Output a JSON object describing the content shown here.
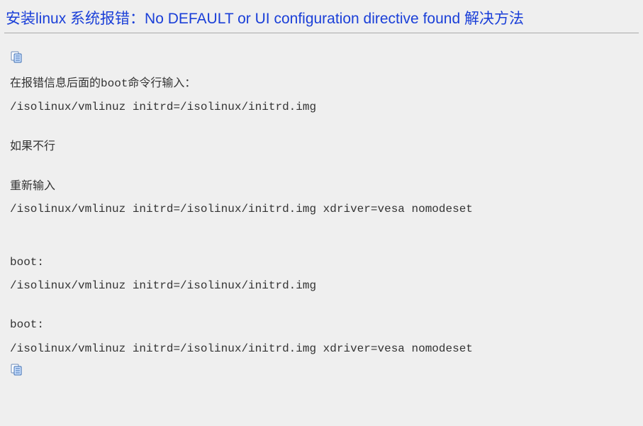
{
  "title": "安装linux 系统报错：No DEFAULT or UI configuration directive found 解决方法",
  "body": {
    "intro_prefix": "在报错信息后面的",
    "intro_boot": "boot",
    "intro_suffix": "命令行输入：",
    "cmd1": "/isolinux/vmlinuz initrd=/isolinux/initrd.img",
    "if_not": "如果不行",
    "retype": "重新输入",
    "cmd2": "/isolinux/vmlinuz initrd=/isolinux/initrd.img xdriver=vesa nomodeset",
    "boot_label_1": "boot:",
    "cmd3": "/isolinux/vmlinuz initrd=/isolinux/initrd.img",
    "boot_label_2": "boot:",
    "cmd4": "/isolinux/vmlinuz initrd=/isolinux/initrd.img xdriver=vesa nomodeset"
  }
}
